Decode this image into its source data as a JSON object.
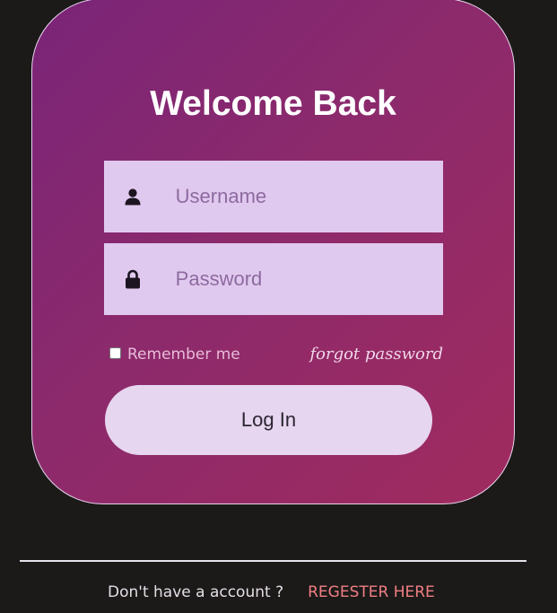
{
  "login": {
    "title": "Welcome Back",
    "username_placeholder": "Username",
    "password_placeholder": "Password",
    "remember_label": "Remember me",
    "forgot_label": "forgot password",
    "login_button": "Log In"
  },
  "footer": {
    "question": "Don't have a account ?",
    "register_link": "REGESTER HERE"
  },
  "icons": {
    "username": "user-icon",
    "password": "lock-icon"
  },
  "colors": {
    "background": "#1b1a18",
    "card_gradient_start": "#7a2478",
    "card_gradient_end": "#a02b5e",
    "input_background": "#e0c9ee",
    "button_background": "#e7d6f0",
    "register_link": "#f07e84"
  }
}
